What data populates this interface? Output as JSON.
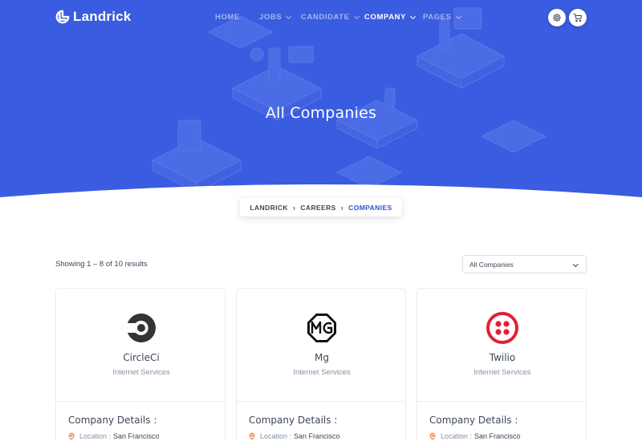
{
  "brand": {
    "name": "Landrick",
    "primary": "#2f55d4",
    "accent": "#f17425"
  },
  "nav": {
    "items": [
      {
        "label": "HOME",
        "dropdown": false,
        "active": false
      },
      {
        "label": "JOBS",
        "dropdown": true,
        "active": false
      },
      {
        "label": "CANDIDATE",
        "dropdown": true,
        "active": false
      },
      {
        "label": "COMPANY",
        "dropdown": true,
        "active": true
      },
      {
        "label": "PAGES",
        "dropdown": true,
        "active": false
      }
    ],
    "settings_icon": "gear-icon",
    "cart_icon": "cart-icon"
  },
  "hero": {
    "title": "All Companies"
  },
  "breadcrumb": [
    {
      "label": "LANDRICK"
    },
    {
      "label": "CAREERS"
    },
    {
      "label": "COMPANIES"
    }
  ],
  "results": {
    "summary": "Showing 1 – 8 of 10 results",
    "filter_selected": "All Companies"
  },
  "companies": [
    {
      "name": "CircleCi",
      "category": "Internet Services",
      "details_heading": "Company Details :",
      "location_label": "Location :",
      "location": "San Francisco",
      "logo_icon": "circleci-logo-icon"
    },
    {
      "name": "Mg",
      "category": "Internet Services",
      "details_heading": "Company Details :",
      "location_label": "Location :",
      "location": "San Francisco",
      "logo_icon": "mg-logo-icon"
    },
    {
      "name": "Twilio",
      "category": "Internet Services",
      "details_heading": "Company Details :",
      "location_label": "Location :",
      "location": "San Francisco",
      "logo_icon": "twilio-logo-icon"
    }
  ]
}
